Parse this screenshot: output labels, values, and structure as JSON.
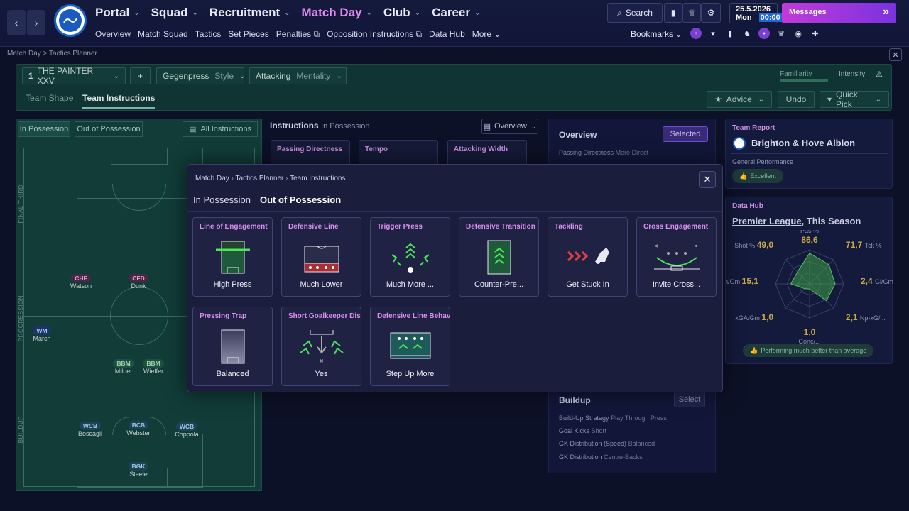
{
  "nav": {
    "back": "‹",
    "forward": "›",
    "main": [
      {
        "label": "Portal",
        "active": false
      },
      {
        "label": "Squad",
        "active": false
      },
      {
        "label": "Recruitment",
        "active": false
      },
      {
        "label": "Match Day",
        "active": true
      },
      {
        "label": "Club",
        "active": false
      },
      {
        "label": "Career",
        "active": false
      }
    ],
    "sub": [
      "Overview",
      "Match Squad",
      "Tactics",
      "Set Pieces",
      "Penalties ⧉",
      "Opposition Instructions ⧉",
      "Data Hub",
      "More ⌄"
    ],
    "search": "Search",
    "date": "25.5.2026",
    "day": "Mon",
    "time": "00:00",
    "messages": "Messages",
    "bookmarks": "Bookmarks"
  },
  "breadcrumb": "Match Day > Tactics Planner",
  "tactic": {
    "number": "1",
    "name": "THE PAINTER XXV",
    "add": "+",
    "style": "Gegenpress",
    "style_label": "Style",
    "mentality": "Attacking",
    "mentality_label": "Mentality",
    "familiarity": "Familiarity",
    "intensity": "Intensity",
    "tab_shape": "Team Shape",
    "tab_instructions": "Team Instructions",
    "advice": "Advice",
    "undo": "Undo",
    "quick_pick": "Quick Pick"
  },
  "pitch": {
    "tab_in": "In Possession",
    "tab_out": "Out of Possession",
    "all_instructions": "All Instructions",
    "zones": [
      "FINAL THIRD",
      "PROGRESSION",
      "BUILDUP"
    ],
    "players": [
      {
        "pos": "CHF",
        "name": "Watson",
        "type": "att"
      },
      {
        "pos": "CFD",
        "name": "Dunk",
        "type": "att"
      },
      {
        "pos": "WM",
        "name": "March",
        "type": "wing"
      },
      {
        "pos": "BBM",
        "name": "Milner",
        "type": "mid"
      },
      {
        "pos": "BBM",
        "name": "Wieffer",
        "type": "mid"
      },
      {
        "pos": "WCB",
        "name": "Boscagli",
        "type": "def"
      },
      {
        "pos": "BCB",
        "name": "Webster",
        "type": "def"
      },
      {
        "pos": "WCB",
        "name": "Coppola",
        "type": "def"
      },
      {
        "pos": "BGK",
        "name": "Steele",
        "type": "def"
      }
    ]
  },
  "instructions": {
    "title": "Instructions",
    "phase": "In Possession",
    "view": "Overview",
    "bg_cards": [
      "Passing Directness",
      "Tempo",
      "Attacking Width"
    ]
  },
  "overview": {
    "title": "Overview",
    "selected": "Selected",
    "rows": [
      {
        "k": "Passing Directness",
        "v": "More Direct"
      }
    ],
    "buildup_title": "Buildup",
    "select": "Select",
    "buildup_rows": [
      {
        "k": "Build-Up Strategy",
        "v": "Play Through Press"
      },
      {
        "k": "Goal Kicks",
        "v": "Short"
      },
      {
        "k": "GK Distribution (Speed)",
        "v": "Balanced"
      },
      {
        "k": "GK Distribution",
        "v": "Centre-Backs"
      }
    ]
  },
  "team_report": {
    "title": "Team Report",
    "club": "Brighton & Hove Albion",
    "perf_label": "General Performance",
    "perf_value": "Excellent"
  },
  "data_hub": {
    "title": "Data Hub",
    "league": "Premier League",
    "period": ", This Season",
    "radar": [
      {
        "label": "Pas %",
        "value": "86,6"
      },
      {
        "label": "Tck %",
        "value": "71,7"
      },
      {
        "label": "Gl/Gm",
        "value": "2,4"
      },
      {
        "label": "Np-xG/...",
        "value": "2,1"
      },
      {
        "label": "Conc/...",
        "value": "1,0"
      },
      {
        "label": "xGA/Gm",
        "value": "1,0"
      },
      {
        "label": "Sh/Gm",
        "value": "15,1"
      },
      {
        "label": "Shot %",
        "value": "49,0"
      }
    ],
    "radar_levels": [
      0.9,
      0.8,
      0.75,
      0.7,
      0.15,
      0.2,
      0.55,
      0.5
    ],
    "footer": "Performing much better than average"
  },
  "modal": {
    "breadcrumb": [
      "Match Day",
      "Tactics Planner",
      "Team Instructions"
    ],
    "close": "✕",
    "tab_in": "In Possession",
    "tab_out": "Out of Possession",
    "cards": [
      {
        "title": "Line of Engagement",
        "value": "High Press"
      },
      {
        "title": "Defensive Line",
        "value": "Much Lower"
      },
      {
        "title": "Trigger Press",
        "value": "Much More ..."
      },
      {
        "title": "Defensive Transition",
        "value": "Counter-Pre..."
      },
      {
        "title": "Tackling",
        "value": "Get Stuck In"
      },
      {
        "title": "Cross Engagement",
        "value": "Invite Cross..."
      },
      {
        "title": "Pressing Trap",
        "value": "Balanced"
      },
      {
        "title": "Short Goalkeeper Distribution",
        "value": "Yes"
      },
      {
        "title": "Defensive Line Behaviour",
        "value": "Step Up More"
      }
    ]
  },
  "colors": {
    "accent": "#d98ef0",
    "pitch": "#113c38",
    "messages_start": "#c03bd8",
    "messages_end": "#7b32e0"
  }
}
